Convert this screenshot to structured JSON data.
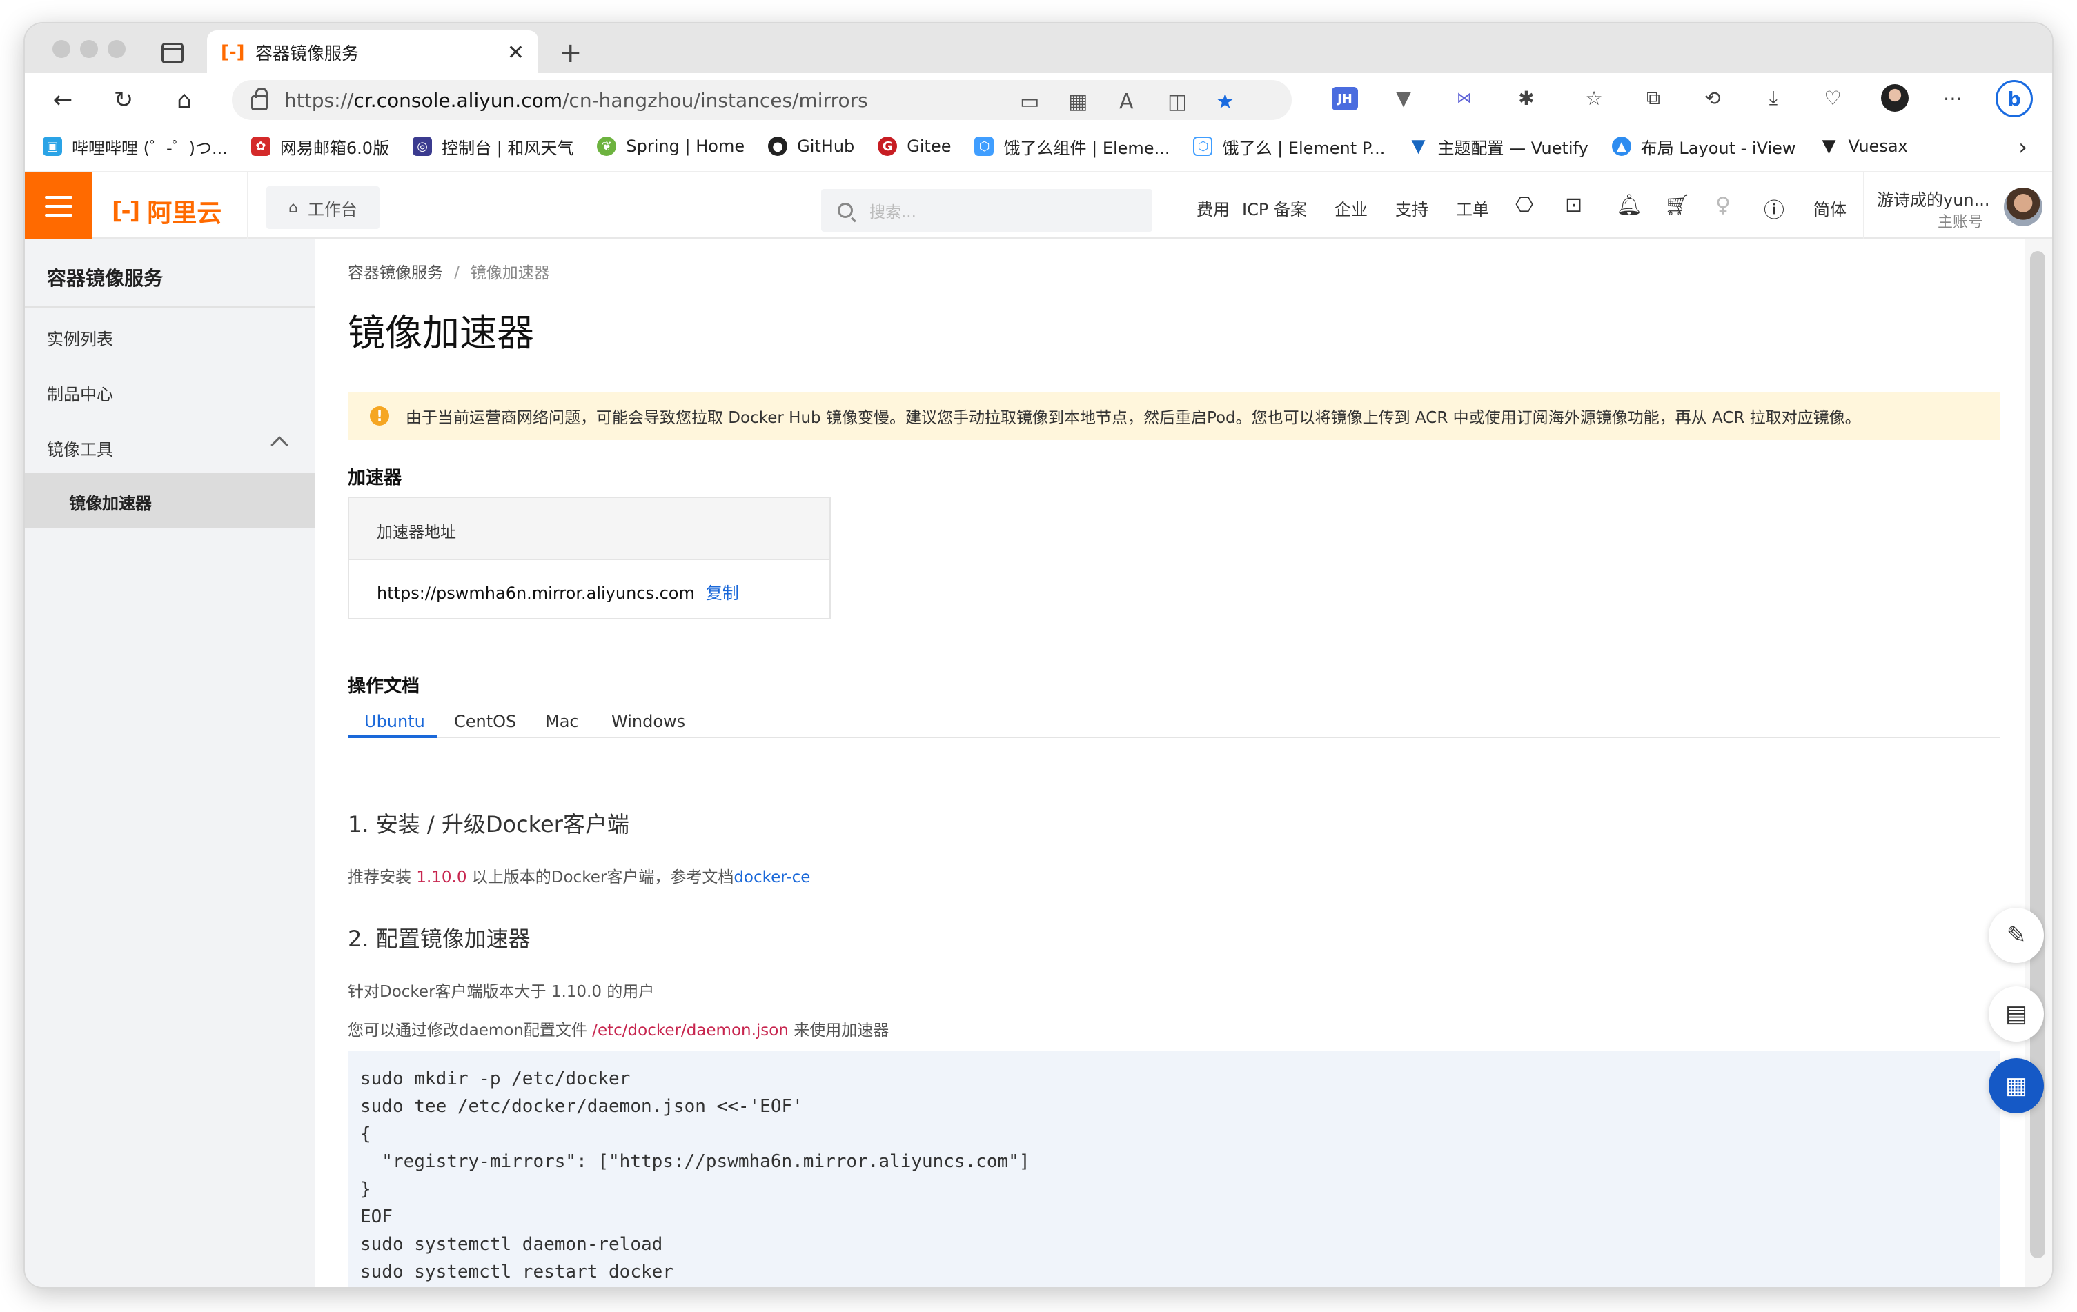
{
  "browser": {
    "tab_title": "容器镜像服务",
    "url_prefix": "https://",
    "url_domain": "cr.console.aliyun.com",
    "url_path": "/cn-hangzhou/instances/mirrors",
    "bookmarks": [
      "哔哩哔哩 (゜-゜)つ...",
      "网易邮箱6.0版",
      "控制台 | 和风天气",
      "Spring | Home",
      "GitHub",
      "Gitee",
      "饿了么组件 | Eleme...",
      "饿了么 | Element P...",
      "主题配置 — Vuetify",
      "布局 Layout - iView",
      "Vuesax"
    ],
    "ext_jh": "JH"
  },
  "console": {
    "logo": "阿里云",
    "workbench": "工作台",
    "search_placeholder": "搜索...",
    "links": [
      "费用",
      "ICP 备案",
      "企业",
      "支持",
      "工单"
    ],
    "lang": "简体",
    "user_name": "游诗成的yun...",
    "user_role": "主账号"
  },
  "sidebar": {
    "title": "容器镜像服务",
    "items": [
      "实例列表",
      "制品中心",
      "镜像工具"
    ],
    "active": "镜像加速器"
  },
  "main": {
    "breadcrumb_root": "容器镜像服务",
    "breadcrumb_sep": "/",
    "breadcrumb_current": "镜像加速器",
    "title": "镜像加速器",
    "notice": "由于当前运营商网络问题，可能会导致您拉取 Docker Hub 镜像变慢。建议您手动拉取镜像到本地节点，然后重启Pod。您也可以将镜像上传到 ACR 中或使用订阅海外源镜像功能，再从 ACR 拉取对应镜像。",
    "accelerator_heading": "加速器",
    "accelerator_col": "加速器地址",
    "accelerator_url": "https://pswmha6n.mirror.aliyuncs.com",
    "copy": "复制",
    "docs_heading": "操作文档",
    "tabs": [
      "Ubuntu",
      "CentOS",
      "Mac",
      "Windows"
    ],
    "step1_title": "1. 安装 / 升级Docker客户端",
    "step1_pre": "推荐安装 ",
    "step1_ver": "1.10.0",
    "step1_mid": " 以上版本的Docker客户端，参考文档",
    "step1_link": "docker-ce",
    "step2_title": "2. 配置镜像加速器",
    "step2_line1": "针对Docker客户端版本大于 1.10.0 的用户",
    "step2_pre": "您可以通过修改daemon配置文件 ",
    "step2_path": "/etc/docker/daemon.json",
    "step2_post": " 来使用加速器",
    "code": "sudo mkdir -p /etc/docker\nsudo tee /etc/docker/daemon.json <<-'EOF'\n{\n  \"registry-mirrors\": [\"https://pswmha6n.mirror.aliyuncs.com\"]\n}\nEOF\nsudo systemctl daemon-reload\nsudo systemctl restart docker"
  }
}
